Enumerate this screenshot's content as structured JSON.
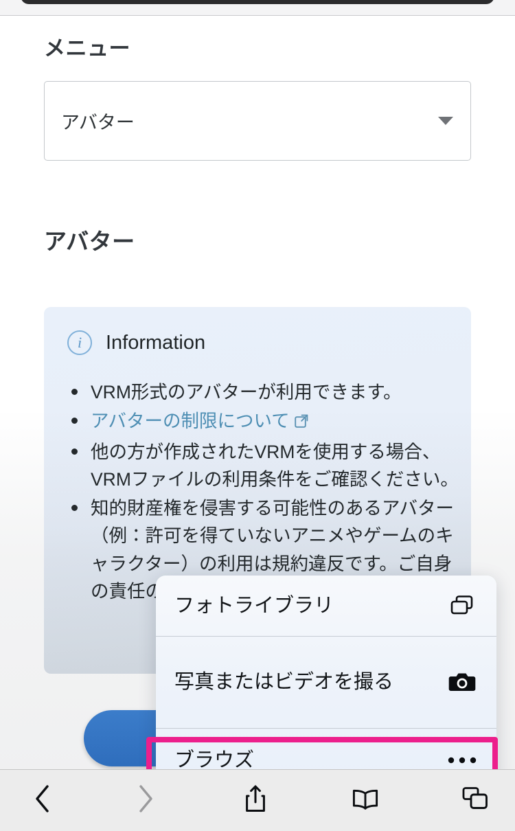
{
  "browser": {
    "toolbar": {
      "back_icon": "chevron-left-icon",
      "forward_icon": "chevron-right-icon",
      "share_icon": "share-icon",
      "bookmarks_icon": "book-icon",
      "tabs_icon": "tabs-icon"
    }
  },
  "page": {
    "menu_heading": "メニュー",
    "select": {
      "value": "アバター",
      "caret_icon": "chevron-down-icon"
    },
    "avatar_heading": "アバター",
    "info_card": {
      "icon": "info-circle-icon",
      "title": "Information",
      "items": [
        {
          "text": "VRM形式のアバターが利用できます。",
          "type": "text"
        },
        {
          "text": "アバターの制限について",
          "type": "link",
          "icon": "external-link-icon"
        },
        {
          "text": "他の方が作成されたVRMを使用する場合、VRMファイルの利用条件をご確認ください。",
          "type": "text"
        },
        {
          "text": "知的財産権を侵害する可能性のあるアバター（例：許可を得ていないアニメやゲームのキャラクター）の利用は規約違反です。ご自身の責任の上ご利用ください。",
          "type": "text"
        }
      ]
    },
    "upload_button": {
      "icon": "cloud-upload-icon",
      "label": ""
    }
  },
  "action_menu": {
    "items": [
      {
        "label": "フォトライブラリ",
        "icon": "photo-library-icon",
        "highlighted": false
      },
      {
        "label": "写真またはビデオを撮る",
        "icon": "camera-icon",
        "highlighted": false
      },
      {
        "label": "ブラウズ",
        "icon": "ellipsis-icon",
        "highlighted": true
      }
    ]
  },
  "annotation": {
    "highlight_color": "#ec1f8c",
    "target": "ブラウズ"
  },
  "colors": {
    "accent_blue": "#2f72c6",
    "info_bg": "#e9f0fa",
    "link_blue": "#4e8fb4",
    "heading": "#32373c"
  }
}
